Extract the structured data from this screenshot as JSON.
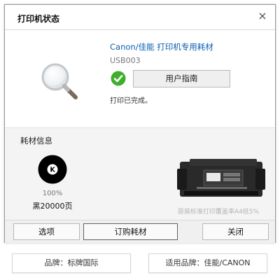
{
  "window": {
    "title": "打印机状态",
    "close_glyph": "×"
  },
  "status": {
    "product_link": "Canon/佳能 打印机专用耗材",
    "port": "USB003",
    "user_guide_label": "用户指南",
    "message": "打印已完成。",
    "ok_color": "#3fae2a"
  },
  "supplies": {
    "heading": "耗材信息",
    "toner": {
      "icon_letter": "K",
      "percent": "100%",
      "level_fraction": 1.0,
      "name": "黑20000页",
      "color": "#000000"
    },
    "image_caption": "原装标准打印覆盖率A4纸5%"
  },
  "buttons": {
    "options": "选项",
    "order": "订购耗材",
    "close": "关闭"
  },
  "tags": {
    "brand": "品牌：标牌国际",
    "compat": "适用品牌：佳能/CANON"
  }
}
